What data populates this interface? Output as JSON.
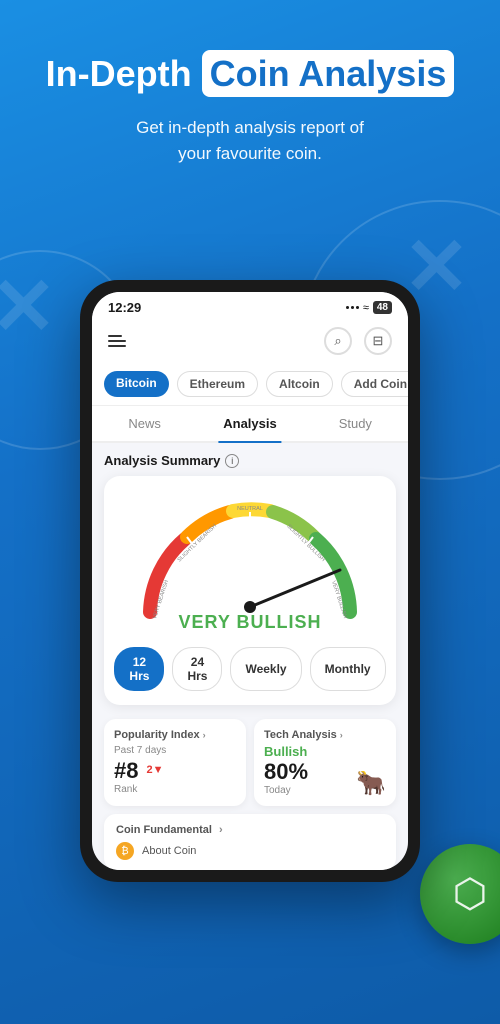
{
  "header": {
    "title_part1": "In-Depth",
    "title_part2": "Coin Analysis",
    "subtitle": "Get in-depth analysis report of\nyour favourite coin."
  },
  "phone": {
    "status_bar": {
      "time": "12:29",
      "battery": "48"
    },
    "coin_tabs": [
      {
        "label": "Bitcoin",
        "active": true
      },
      {
        "label": "Ethereum",
        "active": false
      },
      {
        "label": "Altcoin",
        "active": false
      },
      {
        "label": "Add Coin +",
        "active": false
      }
    ],
    "nav_tabs": [
      {
        "label": "News",
        "active": false
      },
      {
        "label": "Analysis",
        "active": true
      },
      {
        "label": "Study",
        "active": false
      }
    ],
    "analysis_summary": {
      "title": "Analysis Summary",
      "gauge": {
        "value_label": "VERY BULLISH",
        "arc_labels": [
          "VERY BEARISH",
          "SLIGHTLY BEARISH",
          "NEUTRAL",
          "SLIGHTLY BULLISH",
          "VERY BULLISH"
        ]
      },
      "time_buttons": [
        {
          "label": "12 Hrs",
          "active": true
        },
        {
          "label": "24 Hrs",
          "active": false
        },
        {
          "label": "Weekly",
          "active": false
        },
        {
          "label": "Monthly",
          "active": false
        }
      ]
    },
    "cards": {
      "popularity": {
        "title": "Popularity Index",
        "subtitle": "Past 7 days",
        "rank": "#8",
        "change": "2",
        "change_direction": "down",
        "label": "Rank"
      },
      "tech_analysis": {
        "title": "Tech Analysis",
        "sentiment": "Bullish",
        "percent": "80%",
        "period": "Today"
      }
    },
    "fundamental": {
      "title": "Coin Fundamental",
      "item": "About Coin"
    }
  },
  "icons": {
    "menu": "≡",
    "search": "🔍",
    "bookmark": "🔖",
    "info": "i",
    "bull": "🐂",
    "bitcoin_symbol": "₿"
  }
}
